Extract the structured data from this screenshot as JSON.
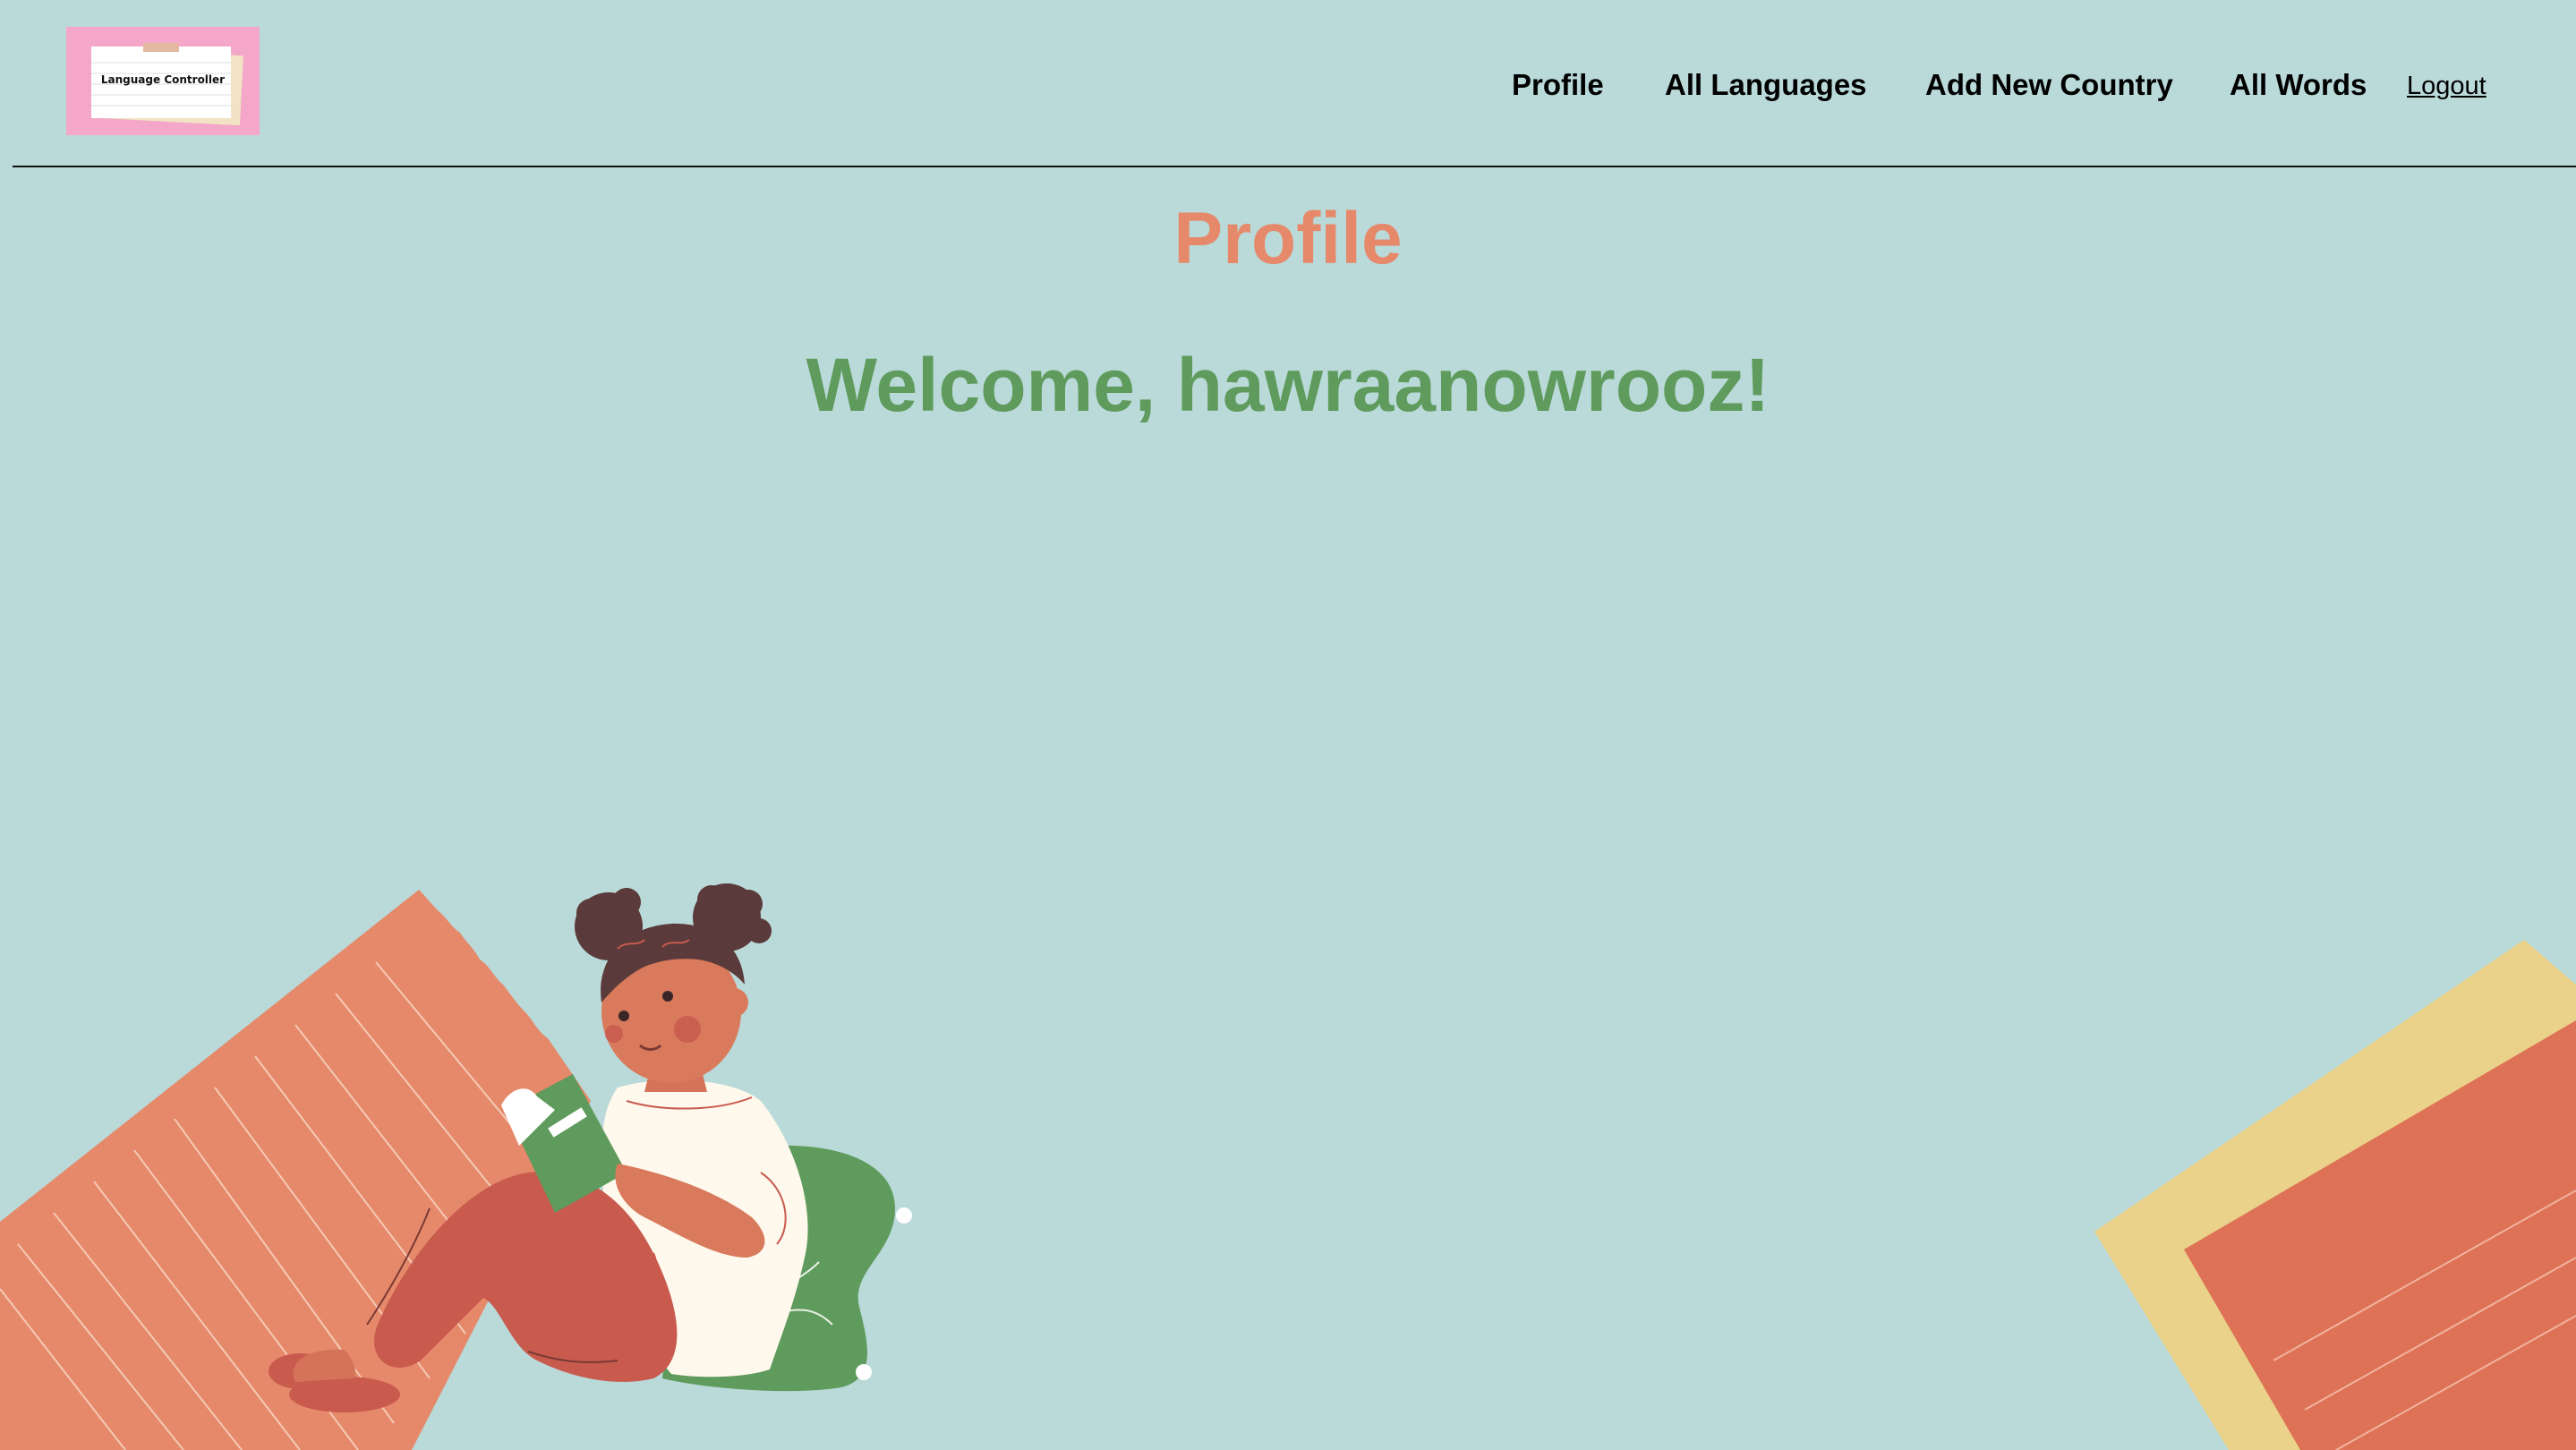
{
  "logo": {
    "text": "Language Controller"
  },
  "nav": {
    "items": [
      {
        "label": "Profile"
      },
      {
        "label": "All Languages"
      },
      {
        "label": "Add New Country"
      },
      {
        "label": "All Words"
      }
    ],
    "logout_label": "Logout"
  },
  "main": {
    "title": "Profile",
    "welcome": "Welcome, hawraanowrooz!"
  },
  "colors": {
    "background": "#bad9d9",
    "title": "#e5896a",
    "welcome": "#5f9b5c",
    "logo_bg": "#f4a7c8"
  },
  "illustrations": {
    "left": "girl-reading-illustration",
    "right": "paper-sheets-illustration"
  }
}
